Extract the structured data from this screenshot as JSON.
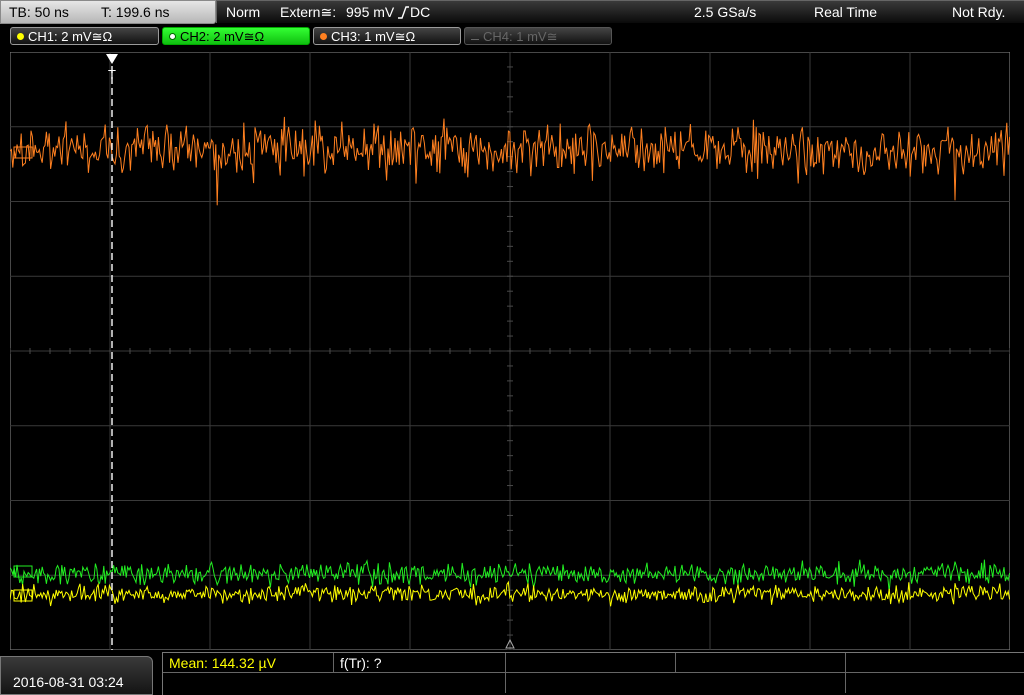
{
  "timebase": {
    "tb": "TB: 50 ns",
    "t": "T: 199.6 ns"
  },
  "status": {
    "mode": "Norm",
    "trigger_source": "Extern≅:",
    "trigger_level": "995 mV",
    "trigger_coupling": "DC",
    "sample_rate": "2.5 GSa/s",
    "acq_mode": "Real Time",
    "state": "Not Rdy."
  },
  "channels": [
    {
      "label": "CH1: 2 mV≅Ω",
      "color": "#ffff00",
      "active": false,
      "enabled": true
    },
    {
      "label": "CH2: 2 mV≅Ω",
      "color": "#22ee22",
      "active": true,
      "enabled": true
    },
    {
      "label": "CH3: 1 mV≅Ω",
      "color": "#ff8020",
      "active": false,
      "enabled": true
    },
    {
      "label": "CH4: 1 mV≅",
      "color": "#666666",
      "active": false,
      "enabled": false
    }
  ],
  "trigger_marker": "T",
  "datetime": "2016-08-31 03:24",
  "measurements": {
    "mean": "Mean: 144.32 µV",
    "freq": "f(Tr): ?"
  }
}
